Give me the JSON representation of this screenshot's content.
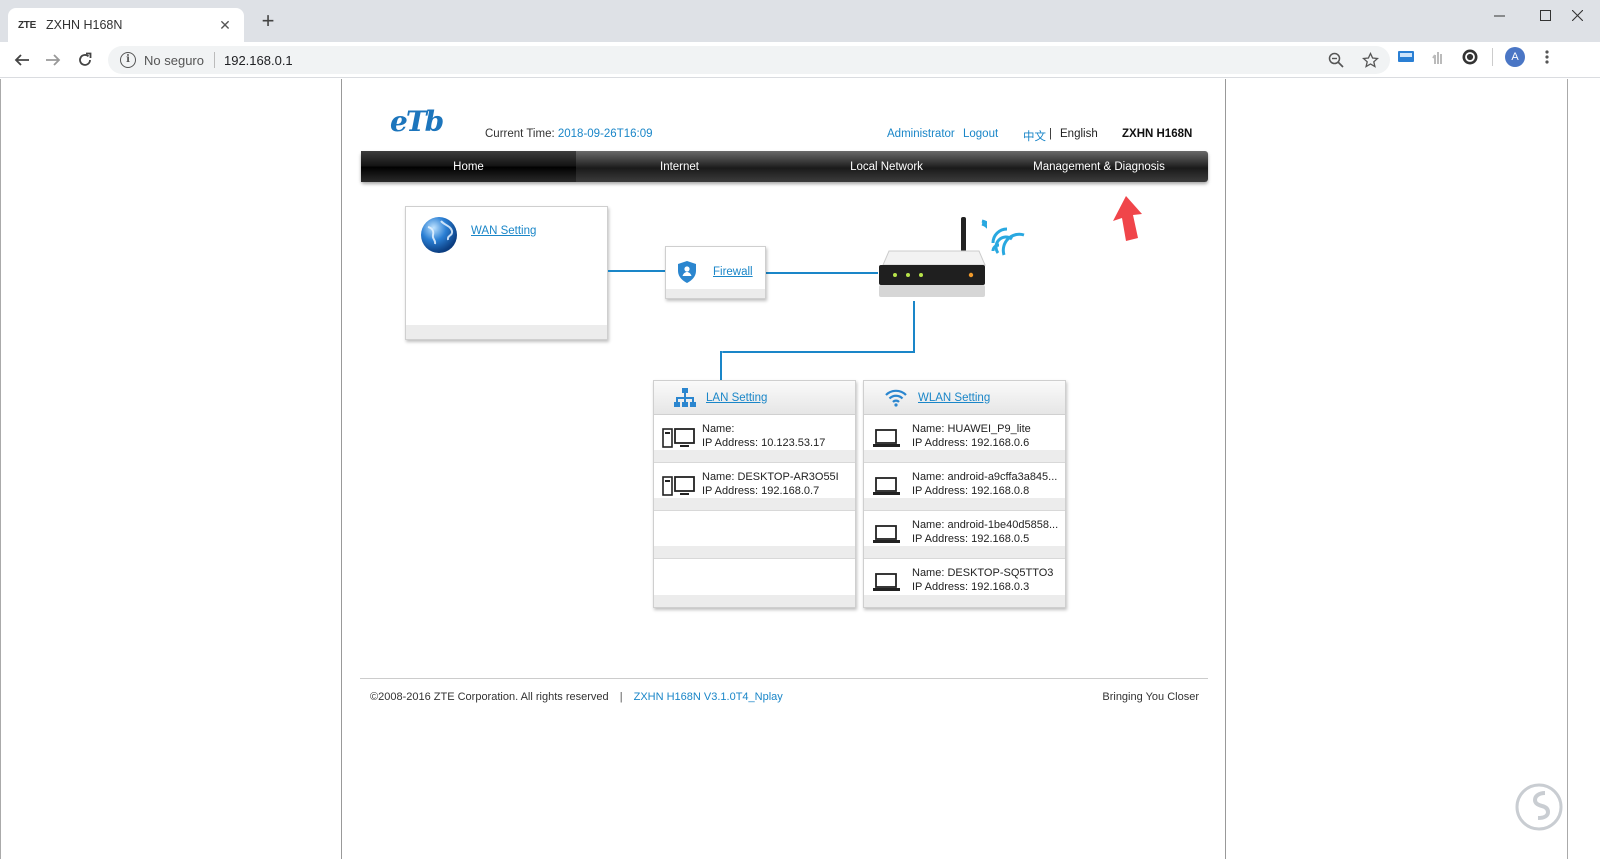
{
  "browser": {
    "tab_favicon": "ZTE",
    "tab_title": "ZXHN H168N",
    "tab_close": "✕",
    "new_tab": "+",
    "security_label": "No seguro",
    "url": "192.168.0.1",
    "profile_initial": "A"
  },
  "header": {
    "logo": "eTb",
    "current_time_label": "Current Time:",
    "current_time_value": "2018-09-26T16:09",
    "admin_label": "Administrator",
    "logout_label": "Logout",
    "lang_chinese": "中文",
    "lang_sep": "|",
    "lang_english": "English",
    "model": "ZXHN H168N"
  },
  "nav": {
    "items": [
      {
        "label": "Home",
        "active": true
      },
      {
        "label": "Internet",
        "active": false
      },
      {
        "label": "Local Network",
        "active": false
      },
      {
        "label": "Management & Diagnosis",
        "active": false
      }
    ]
  },
  "diagram": {
    "wan_label": "WAN Setting",
    "firewall_label": "Firewall",
    "lan": {
      "title": "LAN Setting",
      "devices": [
        {
          "name": "Name:",
          "ip": "IP Address: 10.123.53.17"
        },
        {
          "name": "Name: DESKTOP-AR3O55I",
          "ip": "IP Address: 192.168.0.7"
        }
      ]
    },
    "wlan": {
      "title": "WLAN Setting",
      "devices": [
        {
          "name": "Name: HUAWEI_P9_lite",
          "ip": "IP Address: 192.168.0.6"
        },
        {
          "name": "Name: android-a9cffa3a845...",
          "ip": "IP Address: 192.168.0.8"
        },
        {
          "name": "Name: android-1be40d5858...",
          "ip": "IP Address: 192.168.0.5"
        },
        {
          "name": "Name: DESKTOP-SQ5TTO3",
          "ip": "IP Address: 192.168.0.3"
        }
      ]
    }
  },
  "footer": {
    "copyright": "©2008-2016 ZTE Corporation. All rights reserved",
    "sep": "|",
    "version": "ZXHN H168N V3.1.0T4_Nplay",
    "slogan": "Bringing You Closer"
  },
  "colors": {
    "link": "#1a86c8",
    "wire": "#1a86c8",
    "annotation_arrow": "#f0454a"
  }
}
